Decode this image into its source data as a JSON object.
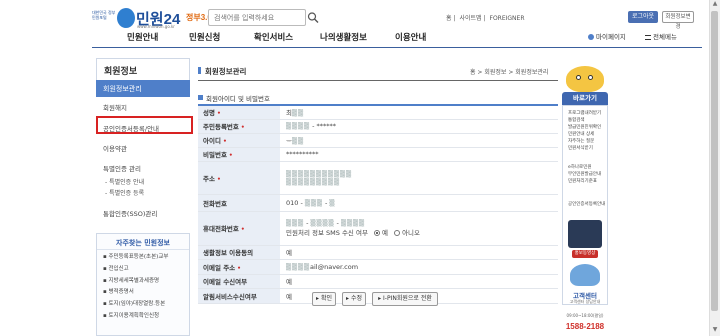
{
  "header": {
    "logo_seal": "대한민국 정부민원포털",
    "logo_name": "민원24",
    "logo_sub": "www.minwon.go.kr",
    "gov3": "정부3.0",
    "search_placeholder": "검색어를 입력하세요",
    "util_links": [
      "홈",
      "사이트맵",
      "FOREIGNER"
    ],
    "logout": "로그아웃",
    "my_info": "회원정보변경"
  },
  "gnb": {
    "menus": [
      "민원안내",
      "민원신청",
      "확인서비스",
      "나의생활정보",
      "이용안내"
    ],
    "my_page": "마이페이지",
    "all_menu": "전체메뉴"
  },
  "lnb": {
    "title": "회원정보",
    "active": "회원정보관리",
    "withdraw": "회원해지",
    "cert": "공인인증서등록/안내",
    "terms": "이용약관",
    "pin": "특별인증 관리",
    "pin_subs": [
      "- 특별인증 안내",
      "- 특별인증 등록"
    ],
    "sso": "통합인증(SSO)관리"
  },
  "freq": {
    "title": "자주찾는 민원정보",
    "items": [
      "주민등록표등본(초본)교부",
      "전입신고",
      "지방세세목별과세증명",
      "병적증명서",
      "토지(임야)대장열람.등본",
      "토지이용계획확인신청"
    ]
  },
  "content": {
    "page_title": "회원정보관리",
    "breadcrumb": "홈 > 회원정보 > 회원정보관리",
    "section_title": "회원아이디 및 비밀번호",
    "rows": [
      {
        "label": "성명",
        "required": true,
        "value": "최"
      },
      {
        "label": "주민등록번호",
        "required": true,
        "value": "******"
      },
      {
        "label": "아이디",
        "required": true,
        "value": "ᅲ"
      },
      {
        "label": "비밀번호",
        "required": true,
        "value": "**********"
      },
      {
        "label": "주소",
        "required": true,
        "value": ""
      },
      {
        "label": "전화번호",
        "required": false,
        "value": "010 -"
      },
      {
        "label": "휴대전화번호",
        "required": true,
        "value": ""
      },
      {
        "label": "생활정보 이용동의",
        "required": false,
        "value": "예"
      },
      {
        "label": "이메일 주소",
        "required": true,
        "value": "ail@naver.com"
      },
      {
        "label": "이메일 수신여부",
        "required": false,
        "value": "예"
      },
      {
        "label": "알림서비스수신여부",
        "required": false,
        "value": "예"
      }
    ],
    "sms_text": "민원처리 정보 SMS 수신 여부",
    "sms_yes": "예",
    "sms_no": "아니오",
    "btn_ok": "확인",
    "btn_edit": "수정",
    "btn_ipin": "I-PIN회원으로 전환"
  },
  "rail": {
    "quick_title": "바로가기",
    "quick_items": [
      "프로그램내려받기",
      "통합검색",
      "발급민원진위확인",
      "민원안내 상세",
      "자주하는 질문",
      "민원서식받기",
      "e하나로민원",
      "무인민원발급안내",
      "민원처리기준표",
      "공인인증서등록안내"
    ],
    "tv_badge": "홍보동영상",
    "help_title": "고객센터",
    "help_sub": "고객센터 상담안내",
    "help_hours": "09:00~18:00(평일)",
    "help_phone": "1588-2188"
  }
}
